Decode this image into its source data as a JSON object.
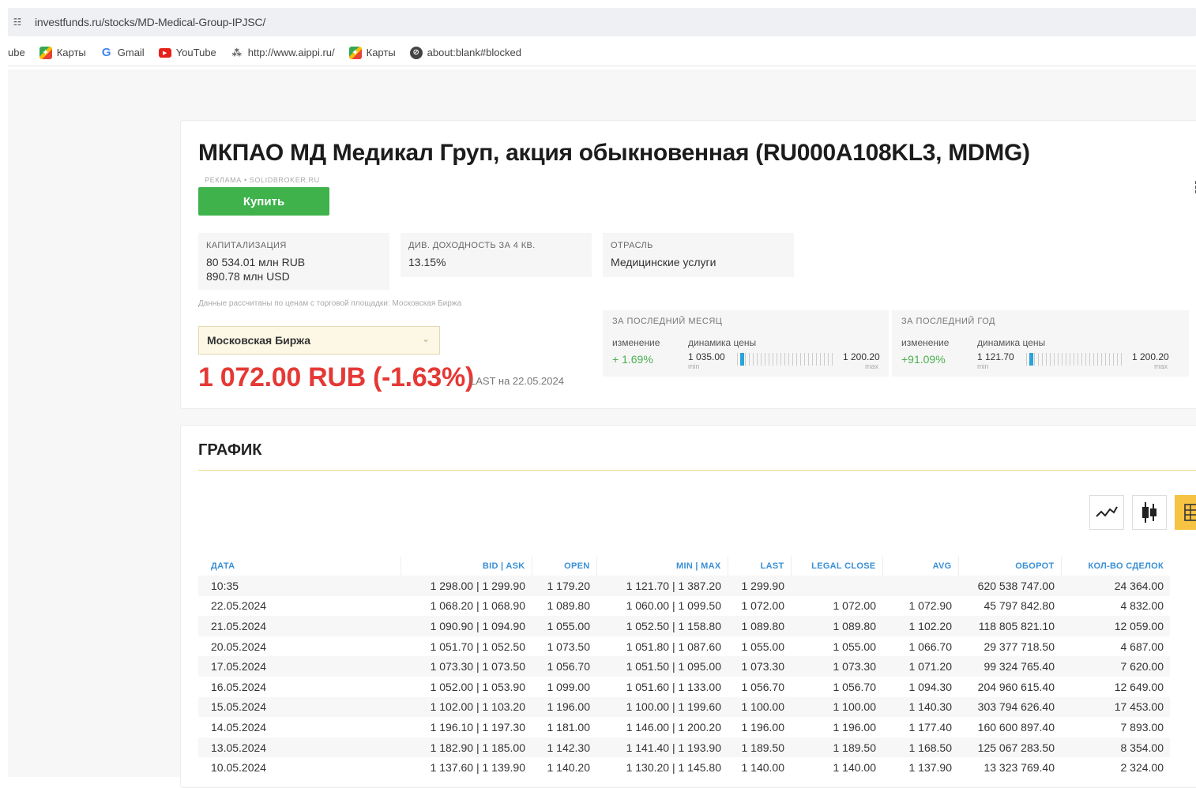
{
  "browser": {
    "url": "investfunds.ru/stocks/MD-Medical-Group-IPJSC/",
    "bookmarks": [
      {
        "label": "ube",
        "icon": "none"
      },
      {
        "label": "Карты",
        "icon": "maps-icon"
      },
      {
        "label": "Gmail",
        "icon": "google-icon"
      },
      {
        "label": "YouTube",
        "icon": "youtube-icon"
      },
      {
        "label": "http://www.aippi.ru/",
        "icon": "aippi-icon"
      },
      {
        "label": "Карты",
        "icon": "maps-icon"
      },
      {
        "label": "about:blank#blocked",
        "icon": "blocked-icon"
      }
    ]
  },
  "header": {
    "title": "МКПАО МД Медикал Груп, акция обыкновенная (RU000A108KL3, MDMG)",
    "ad_label": "РЕКЛАМА • SOLIDBROKER.RU",
    "buy_label": "Купить"
  },
  "info": {
    "cap_label": "КАПИТАЛИЗАЦИЯ",
    "cap_rub": "80 534.01 млн RUB",
    "cap_usd": "890.78 млн USD",
    "div_label": "ДИВ. ДОХОДНОСТЬ ЗА 4 КВ.",
    "div_value": "13.15%",
    "industry_label": "ОТРАСЛЬ",
    "industry_value": "Медицинские услуги",
    "note": "Данные рассчитаны по ценам с торговой площадки: Московская Биржа"
  },
  "exchange": {
    "selected": "Московская Биржа"
  },
  "price": {
    "value": "1 072.00 RUB (-1.63%)",
    "note": "LAST на 22.05.2024"
  },
  "month": {
    "label": "ЗА ПОСЛЕДНИЙ МЕСЯЦ",
    "change_label": "изменение",
    "dyn_label": "динамика цены",
    "change": "+ 1.69%",
    "min": "1 035.00",
    "max": "1 200.20",
    "min_sub": "min",
    "max_sub": "max",
    "position": 0.03
  },
  "year": {
    "label": "ЗА ПОСЛЕДНИЙ ГОД",
    "change_label": "изменение",
    "dyn_label": "динамика цены",
    "change": "+91.09%",
    "min": "1 121.70",
    "max": "1 200.20",
    "min_sub": "min",
    "max_sub": "max",
    "position": 0.03
  },
  "chart_section": {
    "title": "ГРАФИК"
  },
  "view_buttons": [
    {
      "icon": "line-chart-icon",
      "active": false
    },
    {
      "icon": "candlestick-icon",
      "active": false
    },
    {
      "icon": "table-icon",
      "active": true
    }
  ],
  "table": {
    "headers": [
      "ДАТА",
      "BID | ASK",
      "OPEN",
      "MIN | MAX",
      "LAST",
      "LEGAL CLOSE",
      "AVG",
      "ОБОРОТ",
      "КОЛ-ВО СДЕЛОК"
    ],
    "rows": [
      [
        "10:35",
        "1 298.00 | 1 299.90",
        "1 179.20",
        "1 121.70 | 1 387.20",
        "1 299.90",
        "",
        "",
        "620 538 747.00",
        "24 364.00"
      ],
      [
        "22.05.2024",
        "1 068.20 | 1 068.90",
        "1 089.80",
        "1 060.00 | 1 099.50",
        "1 072.00",
        "1 072.00",
        "1 072.90",
        "45 797 842.80",
        "4 832.00"
      ],
      [
        "21.05.2024",
        "1 090.90 | 1 094.90",
        "1 055.00",
        "1 052.50 | 1 158.80",
        "1 089.80",
        "1 089.80",
        "1 102.20",
        "118 805 821.10",
        "12 059.00"
      ],
      [
        "20.05.2024",
        "1 051.70 | 1 052.50",
        "1 073.50",
        "1 051.80 | 1 087.60",
        "1 055.00",
        "1 055.00",
        "1 066.70",
        "29 377 718.50",
        "4 687.00"
      ],
      [
        "17.05.2024",
        "1 073.30 | 1 073.50",
        "1 056.70",
        "1 051.50 | 1 095.00",
        "1 073.30",
        "1 073.30",
        "1 071.20",
        "99 324 765.40",
        "7 620.00"
      ],
      [
        "16.05.2024",
        "1 052.00 | 1 053.90",
        "1 099.00",
        "1 051.60 | 1 133.00",
        "1 056.70",
        "1 056.70",
        "1 094.30",
        "204 960 615.40",
        "12 649.00"
      ],
      [
        "15.05.2024",
        "1 102.00 | 1 103.20",
        "1 196.00",
        "1 100.00 | 1 199.60",
        "1 100.00",
        "1 100.00",
        "1 140.30",
        "303 794 626.40",
        "17 453.00"
      ],
      [
        "14.05.2024",
        "1 196.10 | 1 197.30",
        "1 181.00",
        "1 146.00 | 1 200.20",
        "1 196.00",
        "1 196.00",
        "1 177.40",
        "160 600 897.40",
        "7 893.00"
      ],
      [
        "13.05.2024",
        "1 182.90 | 1 185.00",
        "1 142.30",
        "1 141.40 | 1 193.90",
        "1 189.50",
        "1 189.50",
        "1 168.50",
        "125 067 283.50",
        "8 354.00"
      ],
      [
        "10.05.2024",
        "1 137.60 | 1 139.90",
        "1 140.20",
        "1 130.20 | 1 145.80",
        "1 140.00",
        "1 140.00",
        "1 137.90",
        "13 323 769.40",
        "2 324.00"
      ]
    ]
  }
}
